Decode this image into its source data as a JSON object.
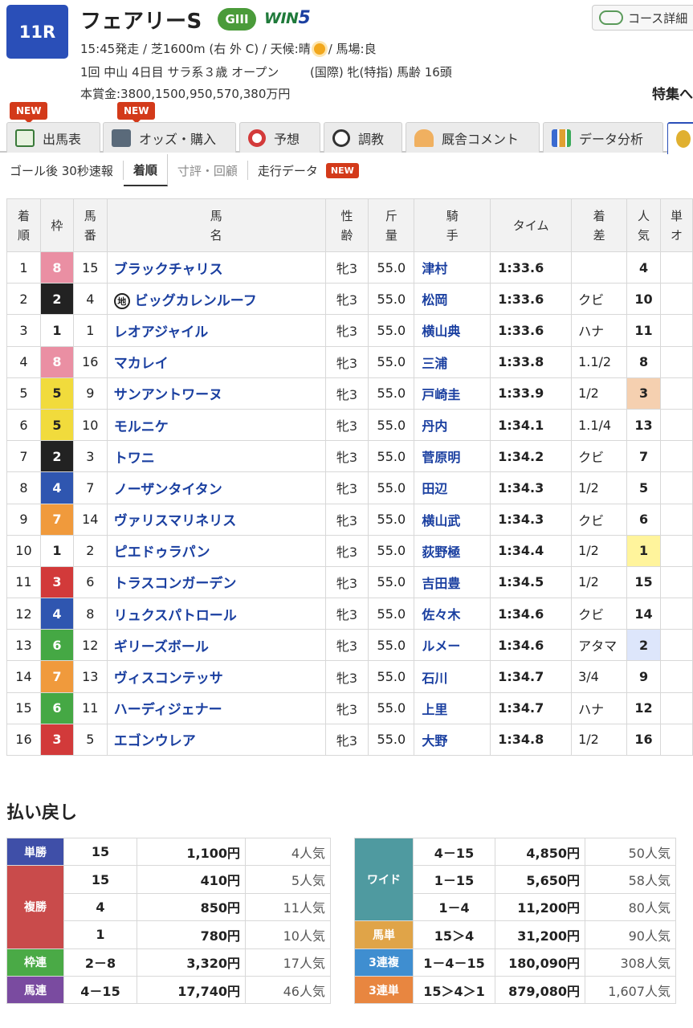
{
  "race": {
    "number": "11R",
    "name": "フェアリーS",
    "grade": "GIII",
    "win5": {
      "prefix": "WIN",
      "suffix": "5"
    },
    "course_button": "コース詳細",
    "line1_pre": "15:45発走 / 芝1600m (右 外 C) / 天候:晴",
    "line1_post": "/ 馬場:良",
    "line2_left": "1回 中山 4日目 サラ系３歳 オープン",
    "line2_right": "(国際) 牝(特指) 馬齢 16頭",
    "line3": "本賞金:3800,1500,950,570,380万円",
    "special": "特集へ"
  },
  "tabs": [
    {
      "label": "出馬表",
      "icon": "entry-table-icon",
      "new": "NEW"
    },
    {
      "label": "オッズ・購入",
      "icon": "ipat-odds-icon",
      "new": "NEW"
    },
    {
      "label": "予想",
      "icon": "target-icon"
    },
    {
      "label": "調教",
      "icon": "stopwatch-icon"
    },
    {
      "label": "厩舎コメント",
      "icon": "stable-icon"
    },
    {
      "label": "データ分析",
      "icon": "bar-chart-icon"
    }
  ],
  "subnav": [
    {
      "label": "ゴール後 30秒速報"
    },
    {
      "label": "着順"
    },
    {
      "label": "寸評・回顧"
    },
    {
      "label": "走行データ",
      "badge": "NEW"
    }
  ],
  "table": {
    "headers": [
      "着順",
      "枠",
      "馬番",
      "馬名",
      "性齢",
      "斤量",
      "騎手",
      "タイム",
      "着差",
      "人気",
      "単オ"
    ],
    "rows": [
      {
        "pos": "1",
        "waku": "8",
        "num": "15",
        "name": "ブラックチャリス",
        "sex": "牝3",
        "kin": "55.0",
        "jockey": "津村",
        "time": "1:33.6",
        "margin": "",
        "pop": "4"
      },
      {
        "pos": "2",
        "waku": "2",
        "num": "4",
        "name": "ビッグカレンルーフ",
        "mark": "地",
        "sex": "牝3",
        "kin": "55.0",
        "jockey": "松岡",
        "time": "1:33.6",
        "margin": "クビ",
        "pop": "10"
      },
      {
        "pos": "3",
        "waku": "1",
        "num": "1",
        "name": "レオアジャイル",
        "sex": "牝3",
        "kin": "55.0",
        "jockey": "横山典",
        "time": "1:33.6",
        "margin": "ハナ",
        "pop": "11"
      },
      {
        "pos": "4",
        "waku": "8",
        "num": "16",
        "name": "マカレイ",
        "sex": "牝3",
        "kin": "55.0",
        "jockey": "三浦",
        "time": "1:33.8",
        "margin": "1.1/2",
        "pop": "8"
      },
      {
        "pos": "5",
        "waku": "5",
        "num": "9",
        "name": "サンアントワーヌ",
        "sex": "牝3",
        "kin": "55.0",
        "jockey": "戸崎圭",
        "time": "1:33.9",
        "margin": "1/2",
        "pop": "3"
      },
      {
        "pos": "6",
        "waku": "5",
        "num": "10",
        "name": "モルニケ",
        "sex": "牝3",
        "kin": "55.0",
        "jockey": "丹内",
        "time": "1:34.1",
        "margin": "1.1/4",
        "pop": "13"
      },
      {
        "pos": "7",
        "waku": "2",
        "num": "3",
        "name": "トワニ",
        "sex": "牝3",
        "kin": "55.0",
        "jockey": "菅原明",
        "time": "1:34.2",
        "margin": "クビ",
        "pop": "7"
      },
      {
        "pos": "8",
        "waku": "4",
        "num": "7",
        "name": "ノーザンタイタン",
        "sex": "牝3",
        "kin": "55.0",
        "jockey": "田辺",
        "time": "1:34.3",
        "margin": "1/2",
        "pop": "5"
      },
      {
        "pos": "9",
        "waku": "7",
        "num": "14",
        "name": "ヴァリスマリネリス",
        "sex": "牝3",
        "kin": "55.0",
        "jockey": "横山武",
        "time": "1:34.3",
        "margin": "クビ",
        "pop": "6"
      },
      {
        "pos": "10",
        "waku": "1",
        "num": "2",
        "name": "ピエドゥラパン",
        "sex": "牝3",
        "kin": "55.0",
        "jockey": "荻野極",
        "time": "1:34.4",
        "margin": "1/2",
        "pop": "1"
      },
      {
        "pos": "11",
        "waku": "3",
        "num": "6",
        "name": "トラスコンガーデン",
        "sex": "牝3",
        "kin": "55.0",
        "jockey": "吉田豊",
        "time": "1:34.5",
        "margin": "1/2",
        "pop": "15"
      },
      {
        "pos": "12",
        "waku": "4",
        "num": "8",
        "name": "リュクスパトロール",
        "sex": "牝3",
        "kin": "55.0",
        "jockey": "佐々木",
        "time": "1:34.6",
        "margin": "クビ",
        "pop": "14"
      },
      {
        "pos": "13",
        "waku": "6",
        "num": "12",
        "name": "ギリーズボール",
        "sex": "牝3",
        "kin": "55.0",
        "jockey": "ルメー",
        "time": "1:34.6",
        "margin": "アタマ",
        "pop": "2"
      },
      {
        "pos": "14",
        "waku": "7",
        "num": "13",
        "name": "ヴィスコンテッサ",
        "sex": "牝3",
        "kin": "55.0",
        "jockey": "石川",
        "time": "1:34.7",
        "margin": "3/4",
        "pop": "9"
      },
      {
        "pos": "15",
        "waku": "6",
        "num": "11",
        "name": "ハーディジェナー",
        "sex": "牝3",
        "kin": "55.0",
        "jockey": "上里",
        "time": "1:34.7",
        "margin": "ハナ",
        "pop": "12"
      },
      {
        "pos": "16",
        "waku": "3",
        "num": "5",
        "name": "エゴンウレア",
        "sex": "牝3",
        "kin": "55.0",
        "jockey": "大野",
        "time": "1:34.8",
        "margin": "1/2",
        "pop": "16"
      }
    ]
  },
  "payout": {
    "title": "払い戻し",
    "left": [
      {
        "label": "単勝",
        "color": "#3f4fa8",
        "entries": [
          {
            "nums": "15",
            "amount": "1,100円",
            "ninki": "4人気"
          }
        ]
      },
      {
        "label": "複勝",
        "color": "#c94b4b",
        "entries": [
          {
            "nums": "15",
            "amount": "410円",
            "ninki": "5人気"
          },
          {
            "nums": "4",
            "amount": "850円",
            "ninki": "11人気"
          },
          {
            "nums": "1",
            "amount": "780円",
            "ninki": "10人気"
          }
        ]
      },
      {
        "label": "枠連",
        "color": "#4aaa46",
        "entries": [
          {
            "nums": "2－8",
            "amount": "3,320円",
            "ninki": "17人気"
          }
        ]
      },
      {
        "label": "馬連",
        "color": "#7a4ba0",
        "entries": [
          {
            "nums": "4－15",
            "amount": "17,740円",
            "ninki": "46人気"
          }
        ]
      }
    ],
    "right": [
      {
        "label": "ワイド",
        "color": "#4f9aa0",
        "entries": [
          {
            "nums": "4－15",
            "amount": "4,850円",
            "ninki": "50人気"
          },
          {
            "nums": "1－15",
            "amount": "5,650円",
            "ninki": "58人気"
          },
          {
            "nums": "1－4",
            "amount": "11,200円",
            "ninki": "80人気"
          }
        ]
      },
      {
        "label": "馬単",
        "color": "#e0a448",
        "entries": [
          {
            "nums": "15＞4",
            "amount": "31,200円",
            "ninki": "90人気"
          }
        ]
      },
      {
        "label": "3連複",
        "color": "#3f8ed0",
        "entries": [
          {
            "nums": "1－4－15",
            "amount": "180,090円",
            "ninki": "308人気"
          }
        ]
      },
      {
        "label": "3連単",
        "color": "#e88640",
        "entries": [
          {
            "nums": "15＞4＞1",
            "amount": "879,080円",
            "ninki": "1,607人気"
          }
        ]
      }
    ]
  }
}
